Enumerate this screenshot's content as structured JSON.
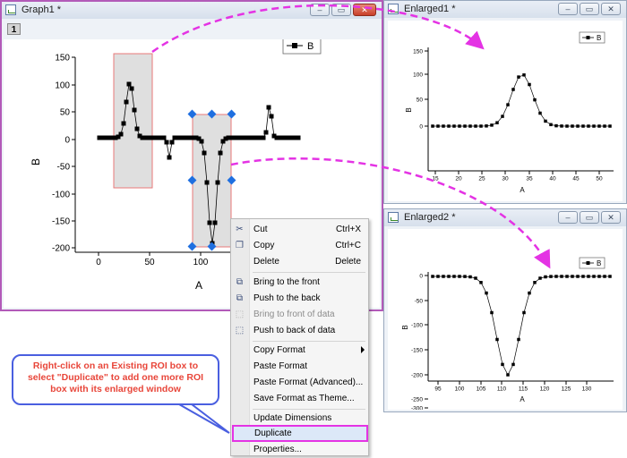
{
  "windows": {
    "graph1": {
      "title": "Graph1 *",
      "layer": "1",
      "legend": "B",
      "xaxis": {
        "label": "A",
        "ticks": [
          "0",
          "50",
          "100"
        ]
      },
      "yaxis": {
        "label": "B",
        "ticks": [
          "150",
          "100",
          "50",
          "0",
          "-50",
          "-100",
          "-150",
          "-200"
        ]
      }
    },
    "enlarged1": {
      "title": "Enlarged1 *",
      "layer": "1",
      "legend": "B",
      "xaxis": {
        "label": "A",
        "ticks": [
          "15",
          "20",
          "25",
          "30",
          "35",
          "40",
          "45",
          "50"
        ]
      },
      "yaxis": {
        "label": "B",
        "ticks": [
          "150",
          "100",
          "50",
          "0"
        ]
      }
    },
    "enlarged2": {
      "title": "Enlarged2 *",
      "layer": "1",
      "legend": "B",
      "xaxis": {
        "label": "A",
        "ticks": [
          "95",
          "100",
          "105",
          "110",
          "115",
          "120",
          "125",
          "130"
        ]
      },
      "yaxis": {
        "label": "B",
        "ticks": [
          "0",
          "-50",
          "-100",
          "-150",
          "-200",
          "-250",
          "-300"
        ]
      }
    }
  },
  "window_buttons": {
    "minimize": "‒",
    "restore": "▭",
    "close": "✕"
  },
  "context_menu": {
    "items": [
      {
        "label": "Cut",
        "shortcut": "Ctrl+X",
        "icon": "scissors-icon"
      },
      {
        "label": "Copy",
        "shortcut": "Ctrl+C",
        "icon": "copy-icon"
      },
      {
        "label": "Delete",
        "shortcut": "Delete",
        "icon": ""
      },
      {
        "label": "Bring to the front",
        "shortcut": "",
        "icon": "bring-front-icon"
      },
      {
        "label": "Push to the back",
        "shortcut": "",
        "icon": "push-back-icon"
      },
      {
        "label": "Bring to front of data",
        "shortcut": "",
        "icon": "bring-front-data-icon",
        "disabled": true
      },
      {
        "label": "Push to back of data",
        "shortcut": "",
        "icon": "push-back-data-icon"
      },
      {
        "label": "Copy Format",
        "shortcut": "",
        "icon": "",
        "submenu": true
      },
      {
        "label": "Paste Format",
        "shortcut": "",
        "icon": ""
      },
      {
        "label": "Paste Format (Advanced)...",
        "shortcut": "",
        "icon": ""
      },
      {
        "label": "Save Format as Theme...",
        "shortcut": "",
        "icon": ""
      },
      {
        "label": "Update Dimensions",
        "shortcut": "",
        "icon": ""
      },
      {
        "label": "Duplicate",
        "shortcut": "",
        "icon": "",
        "highlighted": true
      },
      {
        "label": "Properties...",
        "shortcut": "",
        "icon": ""
      }
    ]
  },
  "callout": {
    "line1": "Right-click on an Existing ROI box to",
    "line2": "select \"Duplicate\" to add one more ROI",
    "line3": "box with its enlarged window"
  },
  "colors": {
    "annotation_magenta": "#e433e4",
    "callout_text": "#e8463a",
    "callout_border": "#4a5fe0",
    "roi_fill": "#d9d9d9",
    "roi_border": "#e87a7a",
    "selection_handle": "#1f6fe0"
  }
}
